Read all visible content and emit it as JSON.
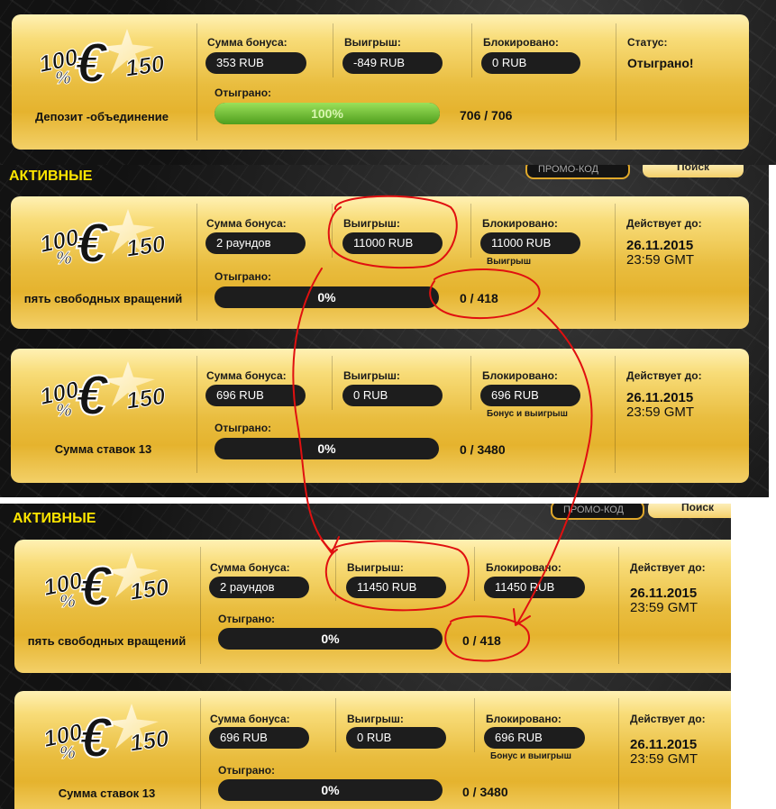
{
  "top_card": {
    "logo": "100 % € 150",
    "name": "Депозит -объединение",
    "bonus_label": "Сумма бонуса:",
    "bonus_value": "353 RUB",
    "win_label": "Выигрыш:",
    "win_value": "-849 RUB",
    "blocked_label": "Блокировано:",
    "blocked_value": "0 RUB",
    "status_label": "Статус:",
    "status_value": "Отыграно!",
    "played_label": "Отыграно:",
    "progress_text": "100%",
    "progress_fraction": 1.0,
    "counter": "706 / 706"
  },
  "section1": {
    "title": "АКТИВНЫЕ",
    "promo_placeholder": "ПРОМО-КОД",
    "search_label": "Поиск",
    "cards": [
      {
        "logo": "100 % € 150",
        "name": "пять свободных вращений",
        "bonus_label": "Сумма бонуса:",
        "bonus_value": "2 раундов",
        "win_label": "Выигрыш:",
        "win_value": "11000 RUB",
        "blocked_label": "Блокировано:",
        "blocked_value": "11000 RUB",
        "blocked_sub": "Выигрыш",
        "valid_label": "Действует до:",
        "valid_date": "26.11.2015",
        "valid_time": "23:59 GMT",
        "played_label": "Отыграно:",
        "progress_text": "0%",
        "progress_fraction": 0,
        "counter": "0 / 418"
      },
      {
        "logo": "100 % € 150",
        "name": "Сумма ставок 13",
        "bonus_label": "Сумма бонуса:",
        "bonus_value": "696 RUB",
        "win_label": "Выигрыш:",
        "win_value": "0 RUB",
        "blocked_label": "Блокировано:",
        "blocked_value": "696 RUB",
        "blocked_sub": "Бонус и выигрыш",
        "valid_label": "Действует до:",
        "valid_date": "26.11.2015",
        "valid_time": "23:59 GMT",
        "played_label": "Отыграно:",
        "progress_text": "0%",
        "progress_fraction": 0,
        "counter": "0 / 3480"
      }
    ]
  },
  "section2": {
    "title": "АКТИВНЫЕ",
    "promo_placeholder": "ПРОМО-КОД",
    "search_label": "Поиск",
    "cards": [
      {
        "logo": "100 % € 150",
        "name": "пять свободных вращений",
        "bonus_label": "Сумма бонуса:",
        "bonus_value": "2 раундов",
        "win_label": "Выигрыш:",
        "win_value": "11450 RUB",
        "blocked_label": "Блокировано:",
        "blocked_value": "11450 RUB",
        "blocked_sub": "",
        "valid_label": "Действует до:",
        "valid_date": "26.11.2015",
        "valid_time": "23:59 GMT",
        "played_label": "Отыграно:",
        "progress_text": "0%",
        "progress_fraction": 0,
        "counter": "0 / 418"
      },
      {
        "logo": "100 % € 150",
        "name": "Сумма ставок 13",
        "bonus_label": "Сумма бонуса:",
        "bonus_value": "696 RUB",
        "win_label": "Выигрыш:",
        "win_value": "0 RUB",
        "blocked_label": "Блокировано:",
        "blocked_value": "696 RUB",
        "blocked_sub": "Бонус и выигрыш",
        "valid_label": "Действует до:",
        "valid_date": "26.11.2015",
        "valid_time": "23:59 GMT",
        "played_label": "Отыграно:",
        "progress_text": "0%",
        "progress_fraction": 0,
        "counter": "0 / 3480"
      }
    ]
  },
  "colors": {
    "section_title": "#ffe600",
    "annotation": "#e01010",
    "progress_fill": "#6cc02a",
    "pill_bg": "#1d1d1d"
  }
}
